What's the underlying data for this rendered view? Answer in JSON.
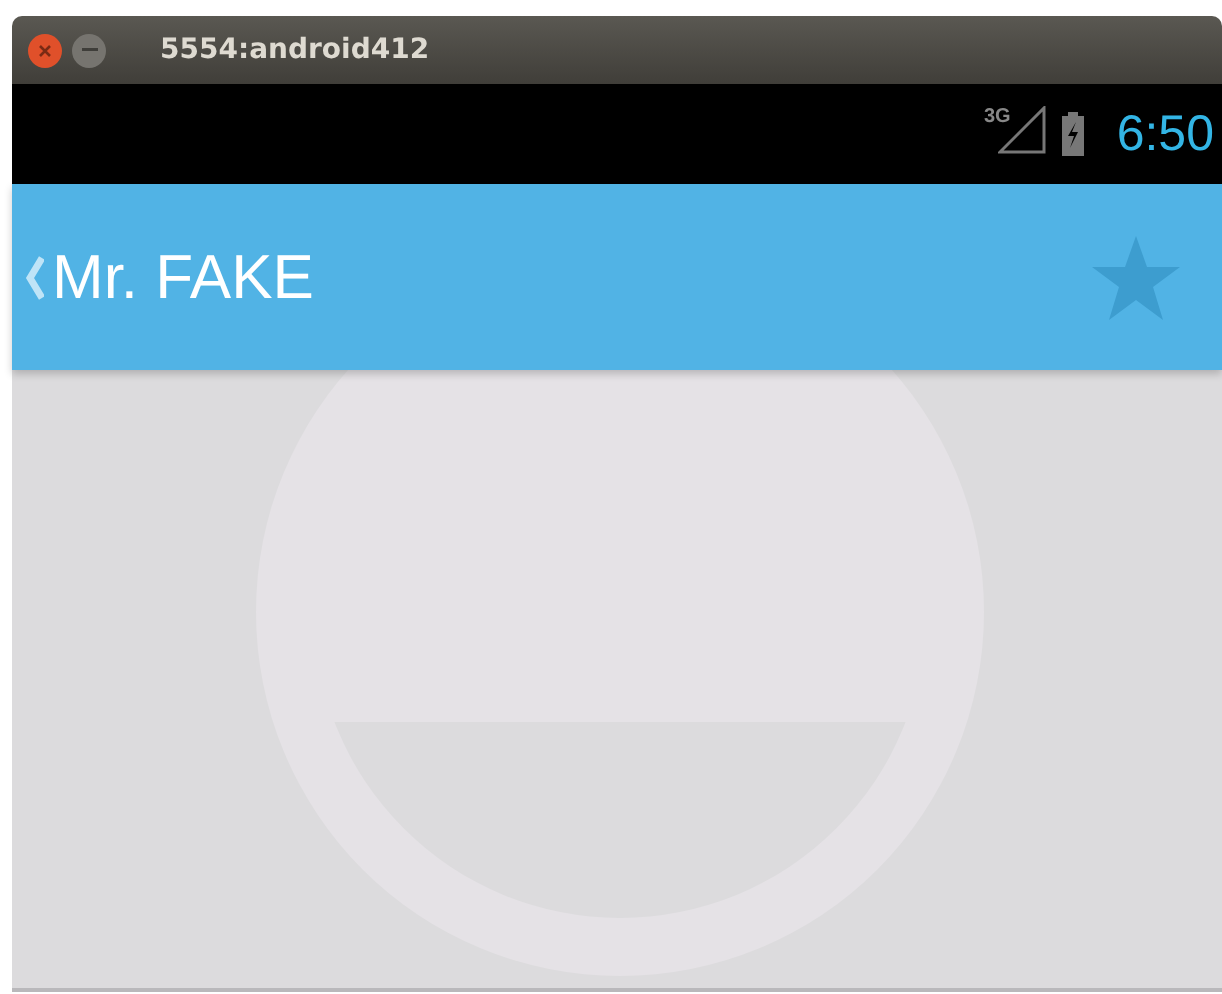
{
  "window": {
    "title": "5554:android412"
  },
  "status_bar": {
    "network": "3G",
    "time": "6:50"
  },
  "action_bar": {
    "title": "Mr. FAKE",
    "favorite": false
  }
}
